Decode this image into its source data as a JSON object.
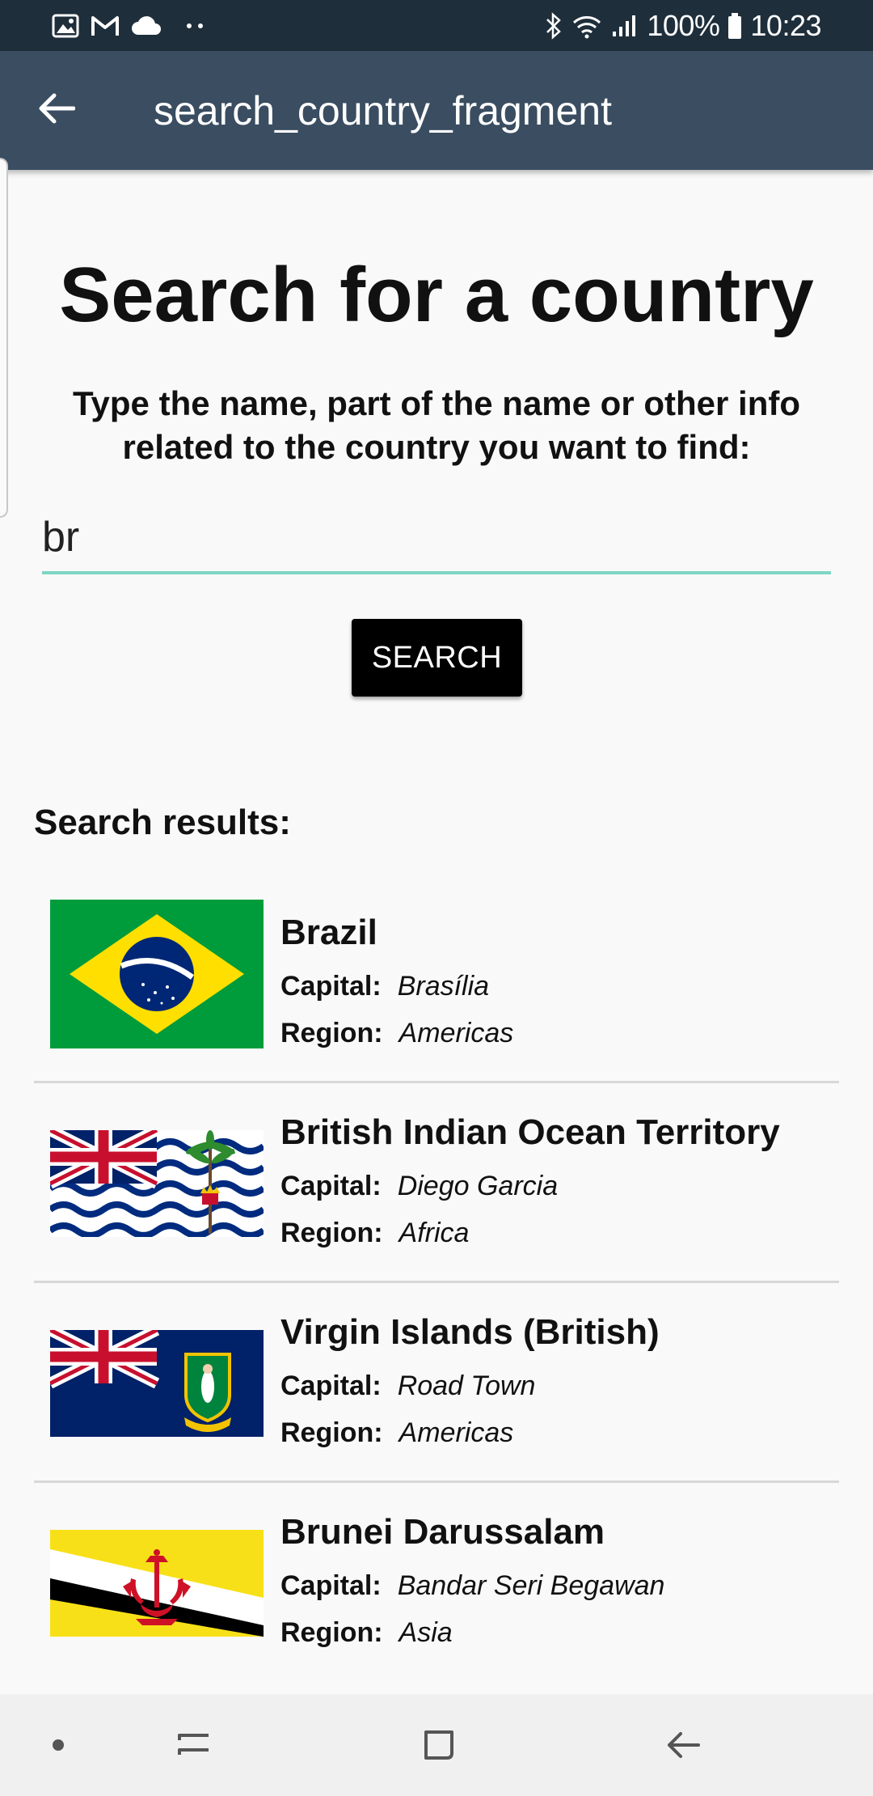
{
  "status_bar": {
    "battery": "100%",
    "time": "10:23",
    "left_icons": [
      "image-icon",
      "gmail-icon",
      "cloud-icon",
      "more-dots-icon"
    ],
    "right_icons": [
      "bluetooth-icon",
      "wifi-icon",
      "signal-icon",
      "battery-icon"
    ]
  },
  "app_bar": {
    "title": "search_country_fragment",
    "back_icon": "arrow-back-icon"
  },
  "main": {
    "headline": "Search for a country",
    "instructions": "Type the name, part of the name or other info related to the country you want to find:",
    "search_value": "br",
    "search_button_label": "SEARCH",
    "results_label": "Search results:"
  },
  "labels": {
    "capital": "Capital:",
    "region": "Region:"
  },
  "results": [
    {
      "name": "Brazil",
      "capital": "Brasília",
      "region": "Americas",
      "flag": "brazil-flag-icon"
    },
    {
      "name": "British Indian Ocean Territory",
      "capital": "Diego Garcia",
      "region": "Africa",
      "flag": "british-indian-ocean-territory-flag-icon"
    },
    {
      "name": "Virgin Islands (British)",
      "capital": "Road Town",
      "region": "Americas",
      "flag": "british-virgin-islands-flag-icon"
    },
    {
      "name": "Brunei Darussalam",
      "capital": "Bandar Seri Begawan",
      "region": "Asia",
      "flag": "brunei-flag-icon"
    }
  ],
  "nav_bar": {
    "items": [
      "dot-icon",
      "recent-apps-icon",
      "home-icon",
      "back-icon"
    ]
  },
  "colors": {
    "status_bar": "#1e2e3b",
    "app_bar": "#3a4d61",
    "input_underline": "#7fd6c4",
    "button": "#000000"
  }
}
